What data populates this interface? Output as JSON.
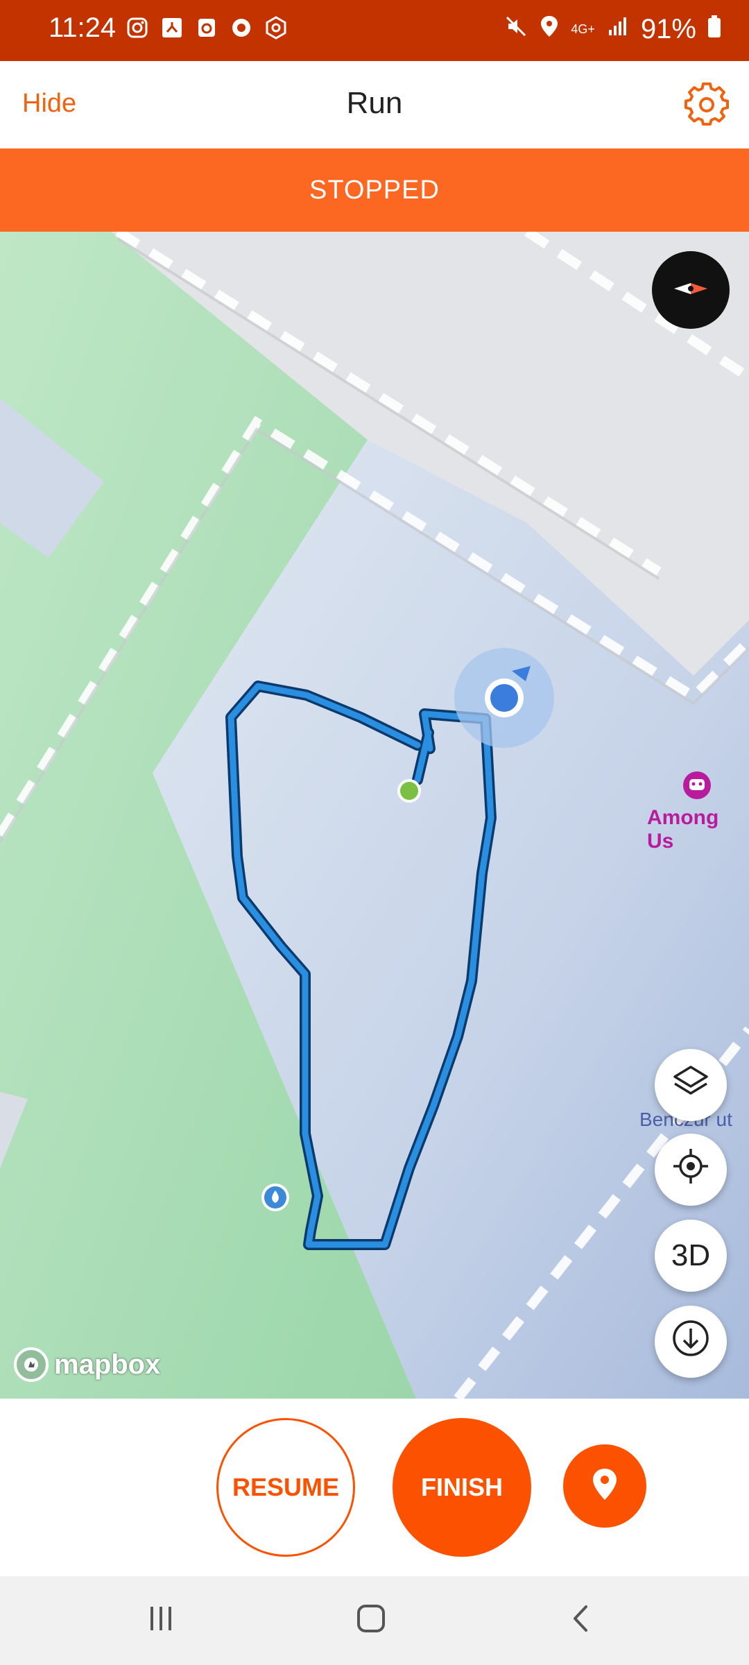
{
  "status_bar": {
    "time": "11:24",
    "battery": "91%",
    "left_icons": [
      "instagram-icon",
      "stickman-icon",
      "clock-app-icon",
      "circle-app-icon",
      "hex-app-icon"
    ],
    "right_icons": [
      "mute-icon",
      "location-icon",
      "network-4g-icon",
      "signal-icon",
      "battery-icon"
    ],
    "network_label": "4G+"
  },
  "header": {
    "hide_label": "Hide",
    "title": "Run",
    "settings_icon": "gear-icon"
  },
  "banner": {
    "state_text": "STOPPED"
  },
  "map": {
    "poi_label": "Among Us",
    "street_label": "Benczúr ut",
    "logo_text": "mapbox",
    "buttons": {
      "layers_icon": "layers-icon",
      "locate_icon": "crosshair-icon",
      "three_d_label": "3D",
      "download_icon": "download-icon",
      "compass_icon": "compass-icon"
    },
    "route_color": "#2a8fe0",
    "start_marker_color": "#7ac043",
    "user_location_color": "#3b7ddd"
  },
  "controls": {
    "resume_label": "RESUME",
    "finish_label": "FINISH",
    "pin_icon": "map-pin-icon"
  },
  "nav": {
    "recents_icon": "recents-icon",
    "home_icon": "home-icon",
    "back_icon": "back-icon"
  },
  "colors": {
    "accent": "#fc5200",
    "status_bar": "#c23300",
    "banner": "#fc6721"
  }
}
